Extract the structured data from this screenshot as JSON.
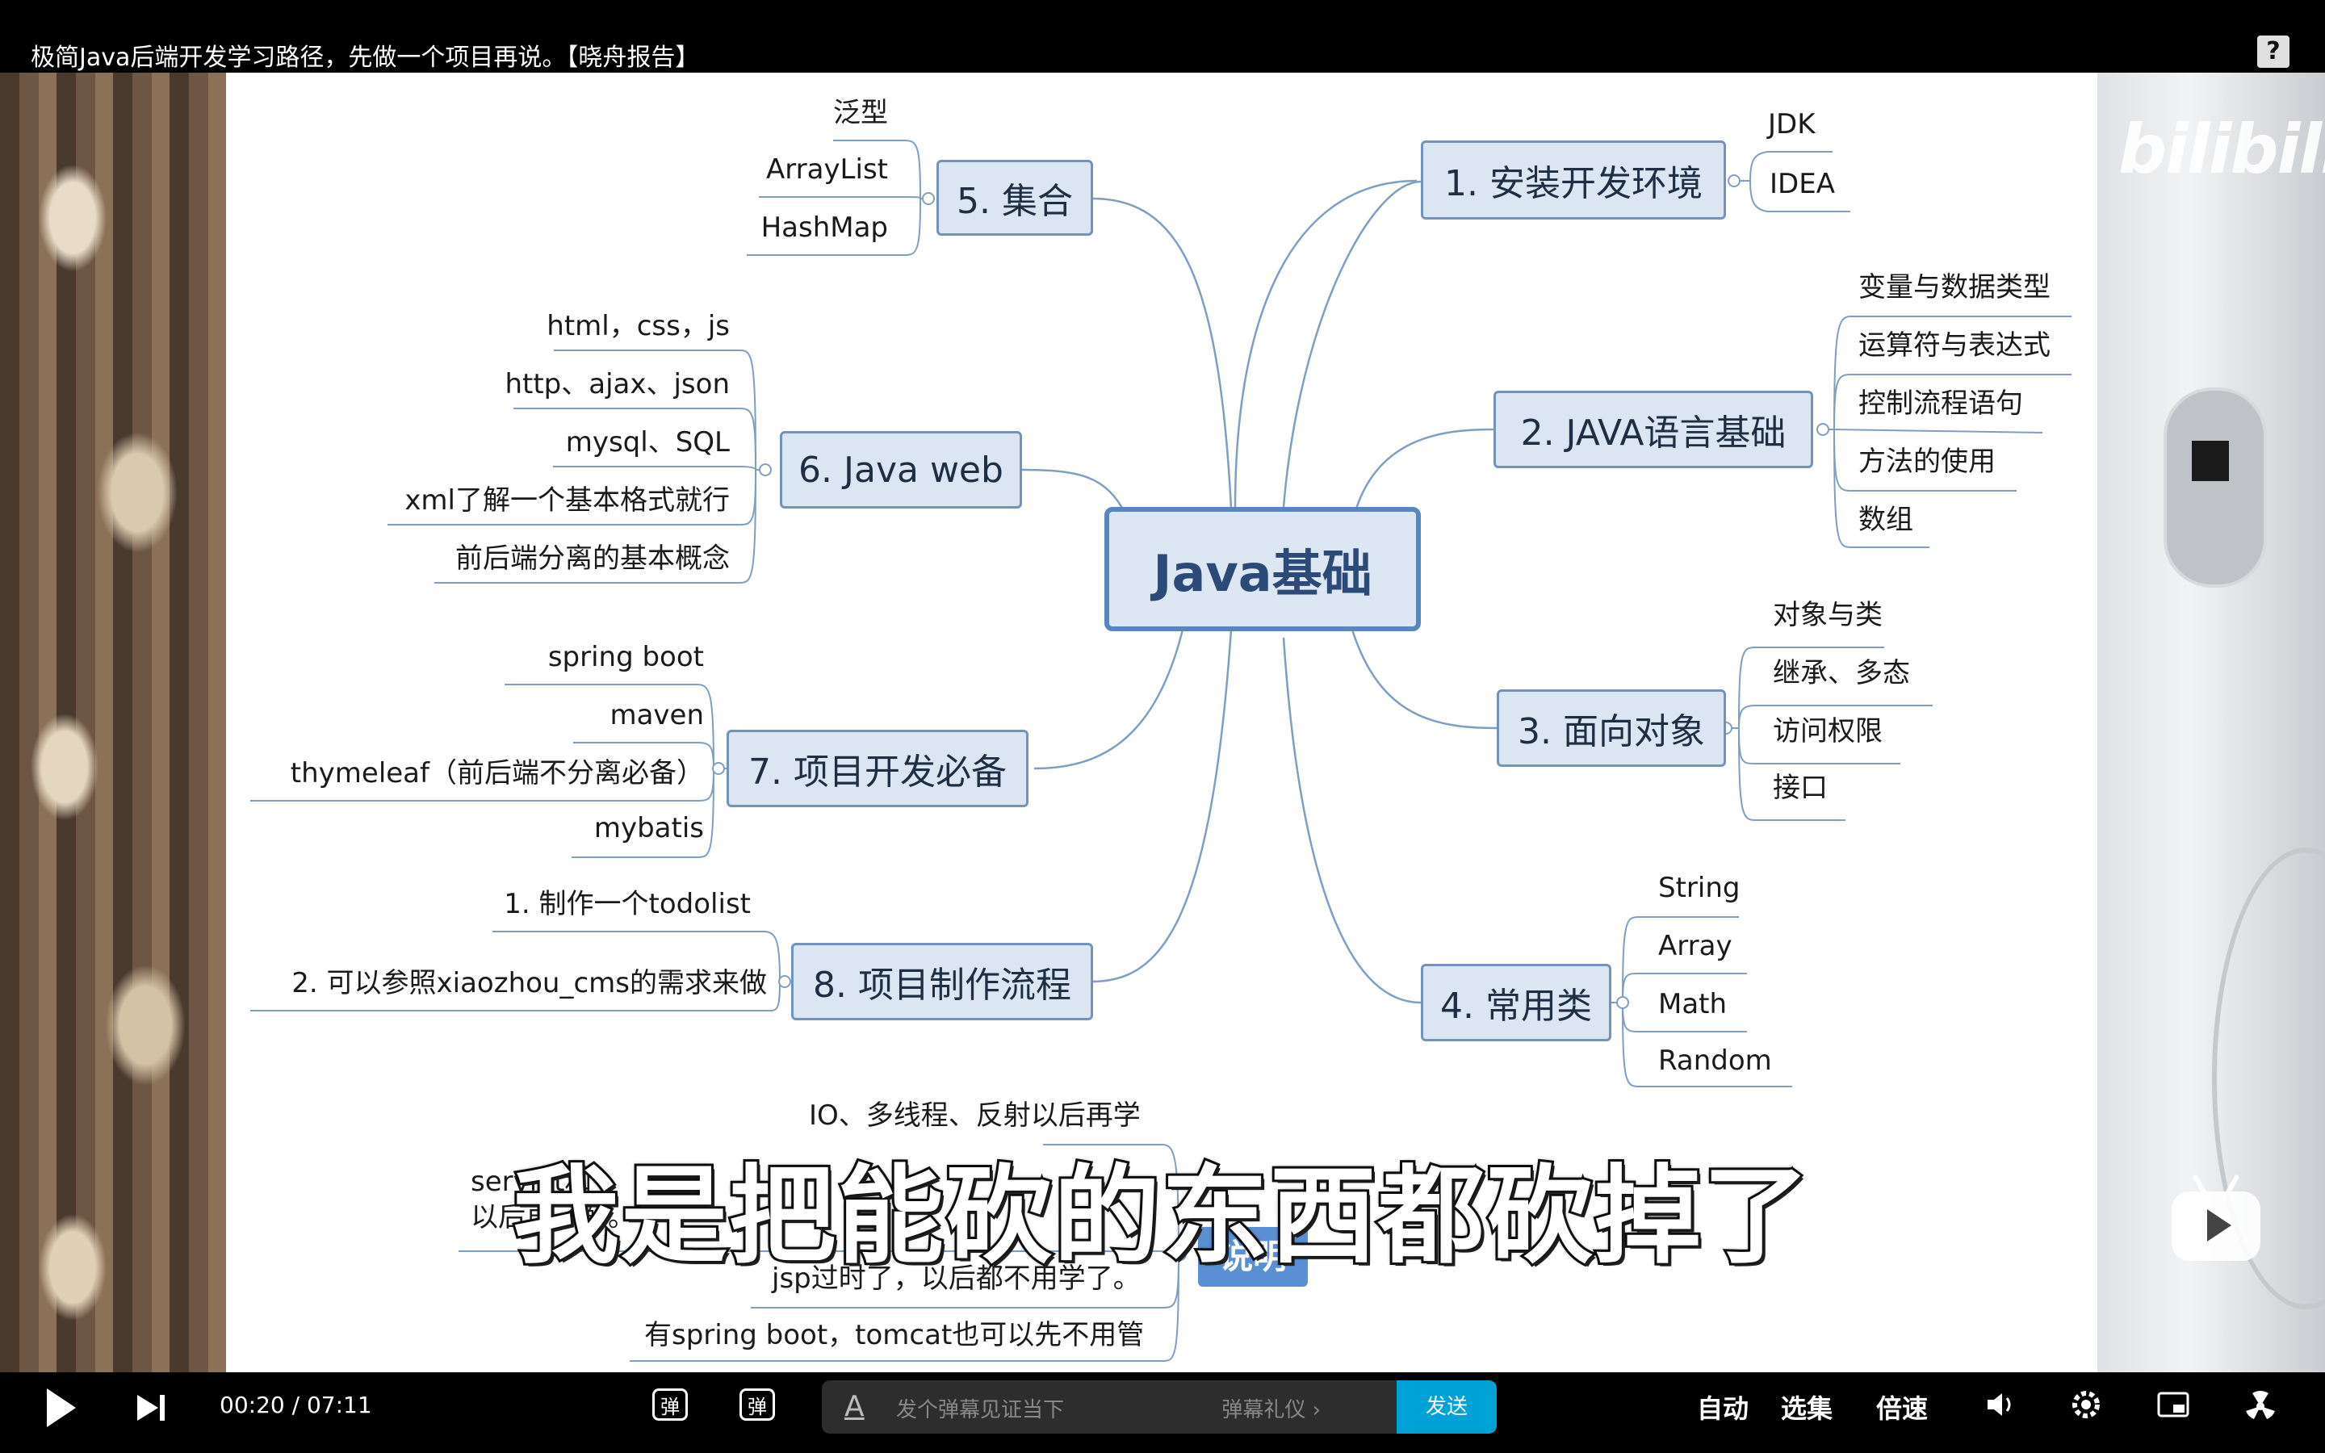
{
  "header": {
    "title": "极简Java后端开发学习路径，先做一个项目再说。【晓舟报告】",
    "help_icon": "?"
  },
  "watermark": {
    "logo": "bilibili"
  },
  "mindmap": {
    "center": "Java基础",
    "branches": [
      {
        "label": "1. 安装开发环境",
        "items": [
          "JDK",
          "IDEA"
        ]
      },
      {
        "label": "2. JAVA语言基础",
        "items": [
          "变量与数据类型",
          "运算符与表达式",
          "控制流程语句",
          "方法的使用",
          "数组"
        ]
      },
      {
        "label": "3. 面向对象",
        "items": [
          "对象与类",
          "继承、多态",
          "访问权限",
          "接口"
        ]
      },
      {
        "label": "4. 常用类",
        "items": [
          "String",
          "Array",
          "Math",
          "Random"
        ]
      },
      {
        "label": "5. 集合",
        "items": [
          "泛型",
          "ArrayList",
          "HashMap"
        ]
      },
      {
        "label": "6. Java web",
        "items": [
          "html，css，js",
          "http、ajax、json",
          "mysql、SQL",
          "xml了解一个基本格式就行",
          "前后端分离的基本概念"
        ]
      },
      {
        "label": "7. 项目开发必备",
        "items": [
          "spring boot",
          "maven",
          "thymeleaf（前后端不分离必备）",
          "mybatis"
        ]
      },
      {
        "label": "8. 项目制作流程",
        "items": [
          "1. 制作一个todolist",
          "2. 可以参照xiaozhou_cms的需求来做"
        ]
      }
    ],
    "note": {
      "label": "说明",
      "items": [
        "IO、多线程、反射以后再学",
        "servlet和",
        "以后再了解。",
        "jsp过时了，以后都不用学了。",
        "有spring boot，tomcat也可以先不用管"
      ]
    }
  },
  "subtitle": "我是把能砍的东西都砍掉了",
  "player": {
    "current_time": "00:20",
    "separator": "/",
    "duration": "07:11",
    "danmaku_toggle": "弹",
    "danmaku_settings": "弹",
    "danmaku_placeholder": "发个弹幕见证当下",
    "danmaku_etiquette": "弹幕礼仪 ›",
    "send_label": "发送",
    "auto_label": "自动",
    "episodes_label": "选集",
    "speed_label": "倍速",
    "icons": [
      "play-icon",
      "next-icon",
      "volume-icon",
      "settings-icon",
      "pip-icon",
      "fullscreen-icon"
    ]
  }
}
